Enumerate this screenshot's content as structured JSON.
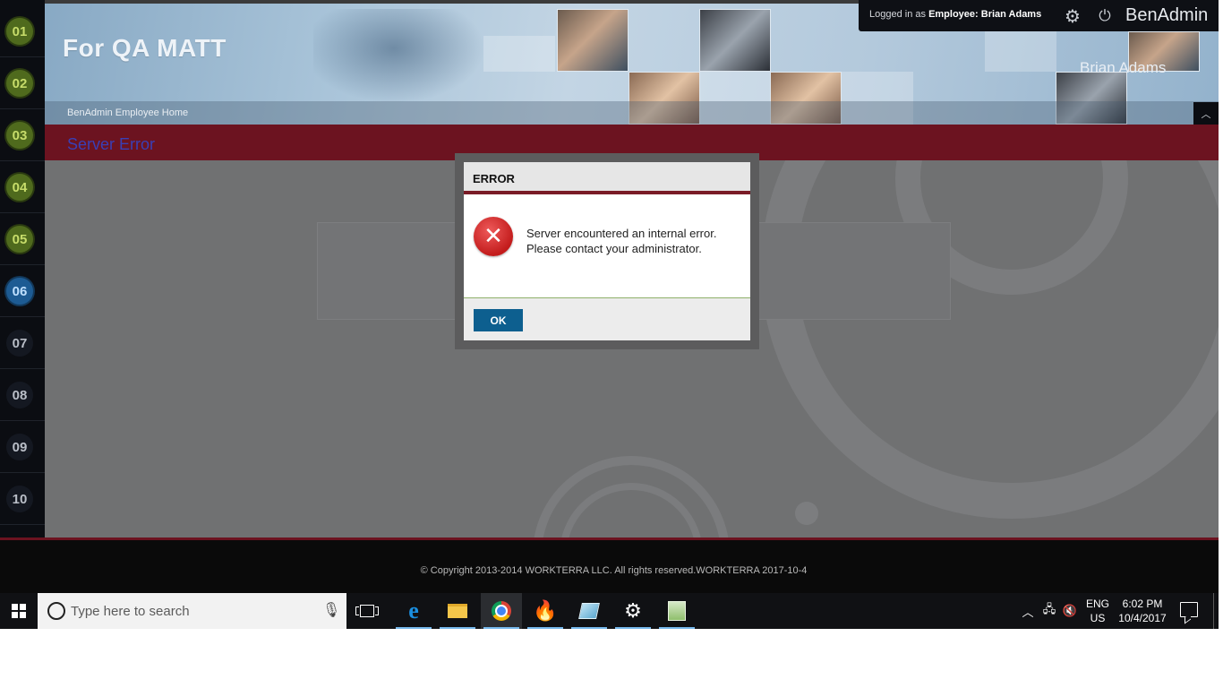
{
  "steps": [
    {
      "label": "01",
      "state": "done"
    },
    {
      "label": "02",
      "state": "done"
    },
    {
      "label": "03",
      "state": "done"
    },
    {
      "label": "04",
      "state": "done"
    },
    {
      "label": "05",
      "state": "done"
    },
    {
      "label": "06",
      "state": "current"
    },
    {
      "label": "07",
      "state": "todo"
    },
    {
      "label": "08",
      "state": "todo"
    },
    {
      "label": "09",
      "state": "todo"
    },
    {
      "label": "10",
      "state": "todo"
    }
  ],
  "header": {
    "site_title": "For QA MATT",
    "breadcrumb": "BenAdmin Employee Home",
    "banner_user": "Brian Adams",
    "logged_in_prefix": "Logged in as",
    "role": "Employee:",
    "user_name": "Brian Adams",
    "brand": "BenAdmin",
    "settings_icon": "gear-icon",
    "logout_icon": "power-icon",
    "collapse_icon": "chevron-up-icon"
  },
  "page": {
    "title": "Server Error"
  },
  "dialog": {
    "title": "ERROR",
    "icon": "error-x-icon",
    "message": "Server encountered an internal error. Please contact your administrator.",
    "ok_label": "OK"
  },
  "footer": {
    "copyright": "© Copyright 2013-2014 WORKTERRA LLC. All rights reserved.WORKTERRA 2017-10-4"
  },
  "taskbar": {
    "search_placeholder": "Type here to search",
    "pinned": [
      "edge-icon",
      "file-explorer-icon",
      "chrome-icon",
      "firefox-icon",
      "notes-icon",
      "settings-icon",
      "calculator-icon"
    ],
    "active_app": "chrome-icon",
    "lang_line1": "ENG",
    "lang_line2": "US",
    "time": "6:02 PM",
    "date": "10/4/2017"
  },
  "colors": {
    "brand_maroon": "#6c1320",
    "ok_button": "#0d5f8f",
    "error_red": "#c31c1c",
    "step_done": "#4f6a1d",
    "step_current": "#1d5b93"
  }
}
